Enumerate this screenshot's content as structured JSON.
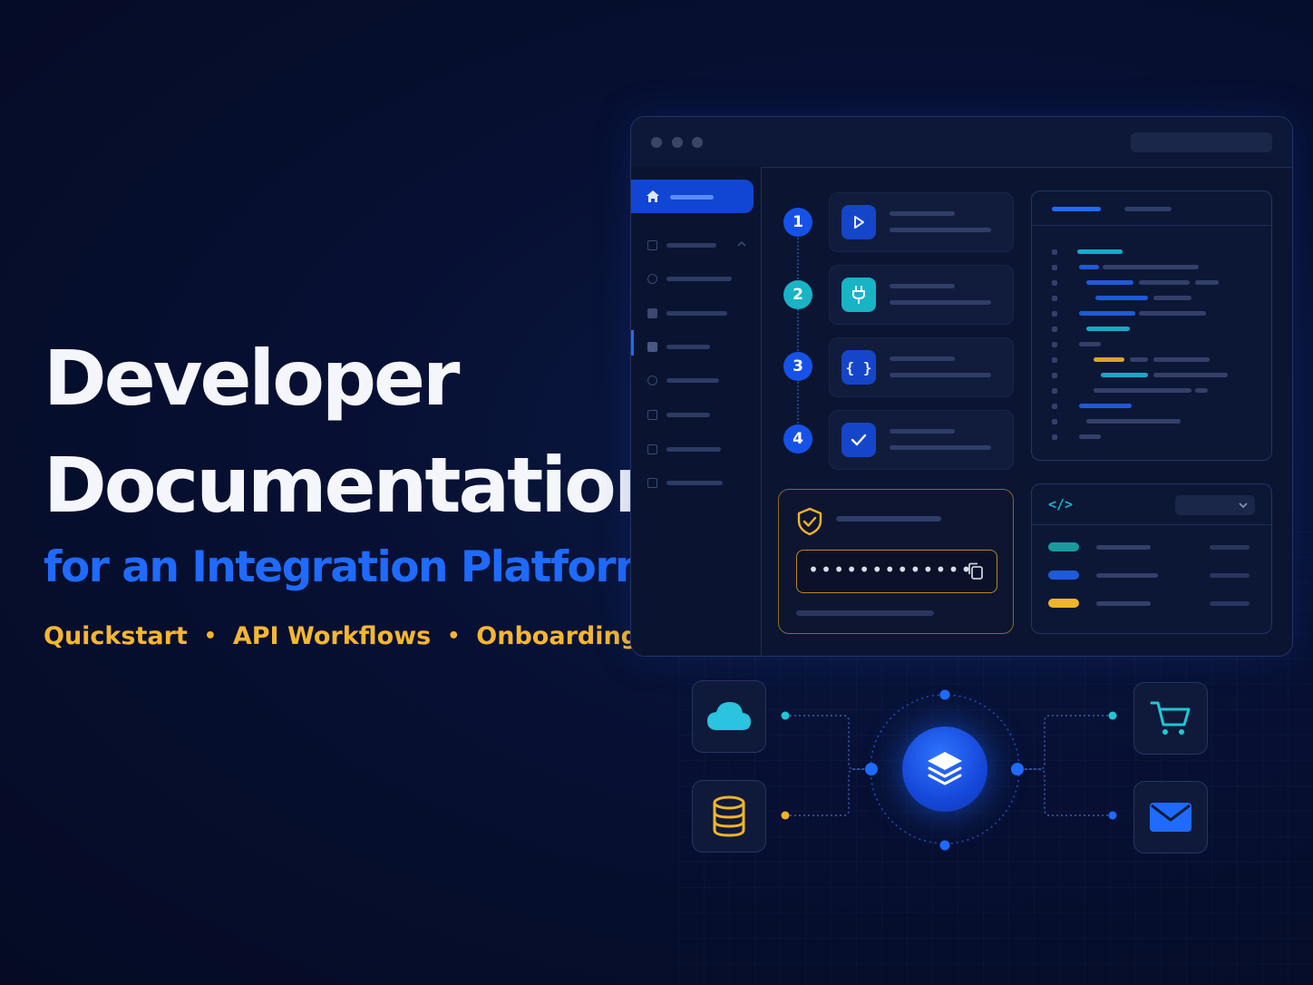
{
  "hero": {
    "title_line1": "Developer",
    "title_line2": "Documentation",
    "subtitle": "for an Integration Platform",
    "tags": [
      "Quickstart",
      "API Workflows",
      "Onboarding"
    ],
    "separator": "•"
  },
  "window": {
    "steps": [
      {
        "number": "1",
        "icon": "play-icon",
        "color": "#1652e8"
      },
      {
        "number": "2",
        "icon": "plug-icon",
        "color": "#18b4c6"
      },
      {
        "number": "3",
        "icon": "braces-icon",
        "color": "#1652e8"
      },
      {
        "number": "4",
        "icon": "check-icon",
        "color": "#1652e8"
      }
    ],
    "step3_glyph": "{ }",
    "api_key_masked": "•••••••••••••",
    "code_tag": "</>"
  },
  "colors": {
    "accent_blue": "#1f6bff",
    "accent_teal": "#18b4c6",
    "accent_gold": "#f5b631",
    "background": "#071033"
  },
  "integrations": {
    "left": [
      "cloud-icon",
      "database-icon"
    ],
    "right": [
      "cart-icon",
      "mail-icon"
    ],
    "hub": "layers-icon"
  }
}
